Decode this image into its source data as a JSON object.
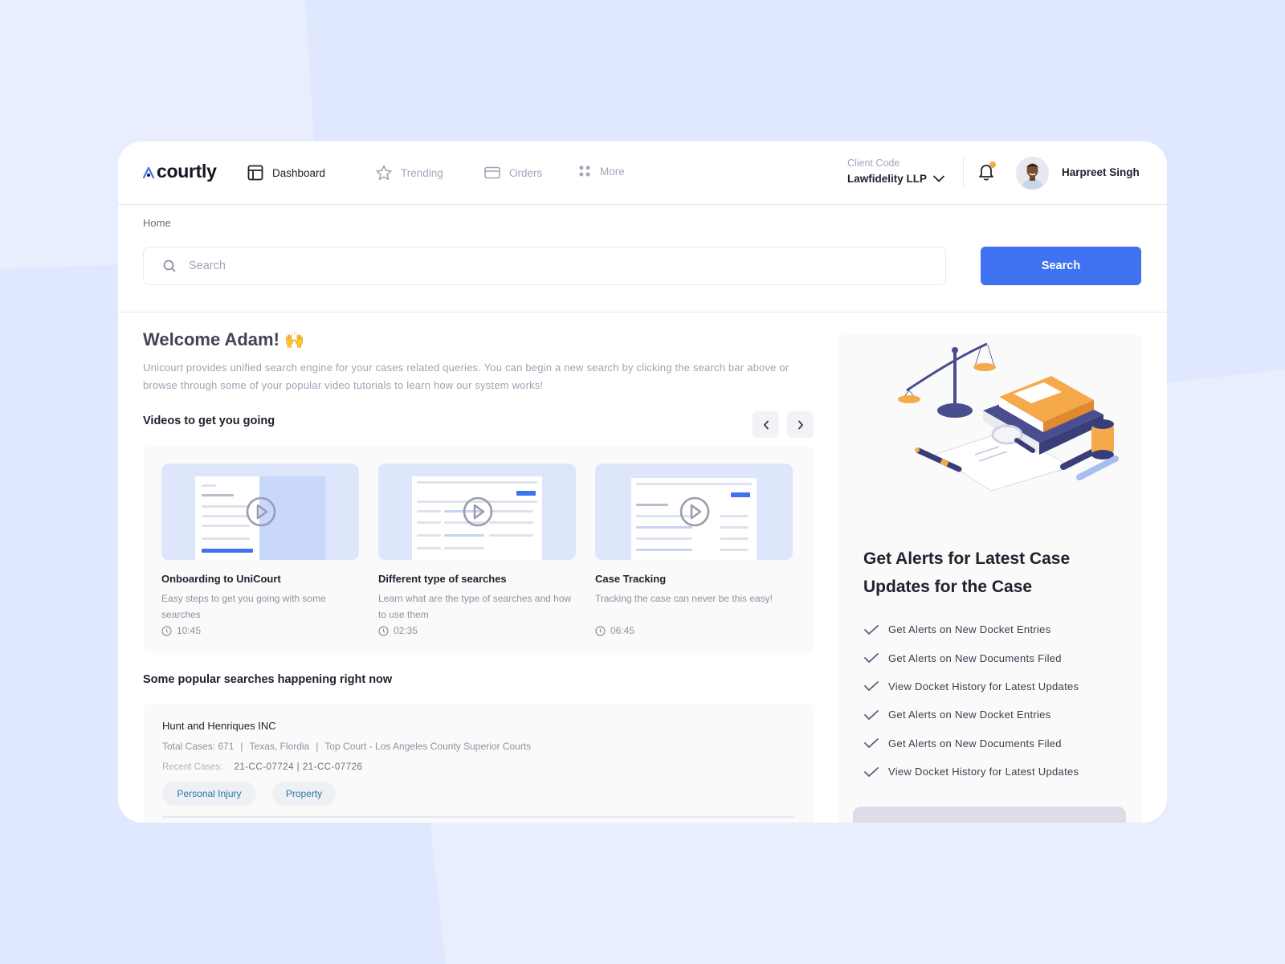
{
  "brand": {
    "name": "courtly",
    "accent": "#3f72f0",
    "highlight": "#f5a94a"
  },
  "nav": {
    "items": [
      {
        "label": "Dashboard",
        "icon": "dashboard-icon",
        "active": true
      },
      {
        "label": "Trending",
        "icon": "star-icon",
        "active": false
      },
      {
        "label": "Orders",
        "icon": "card-icon",
        "active": false
      },
      {
        "label": "More",
        "icon": "grid-dots-icon",
        "active": false
      }
    ]
  },
  "client": {
    "label": "Client Code",
    "value": "Lawfidelity LLP"
  },
  "user": {
    "name": "Harpreet Singh",
    "has_notification": true
  },
  "breadcrumb": "Home",
  "search": {
    "placeholder": "Search",
    "value": "",
    "button_label": "Search"
  },
  "welcome": {
    "title": "Welcome Adam!",
    "emoji": "🙌",
    "text": "Unicourt provides unified search engine for your cases related queries. You can begin a new search by clicking the search bar above or browse through some of your popular video tutorials to learn how our system works!"
  },
  "videos": {
    "title": "Videos to get you going",
    "prev_icon": "chevron-left-icon",
    "next_icon": "chevron-right-icon",
    "items": [
      {
        "title": "Onboarding to UniCourt",
        "description": "Easy steps to get you going with some searches",
        "duration": "10:45"
      },
      {
        "title": "Different type of searches",
        "description": "Learn what are the type of searches and how to use them",
        "duration": "02:35"
      },
      {
        "title": "Case Tracking",
        "description": "Tracking the case can never be this easy!",
        "duration": "06:45"
      }
    ]
  },
  "popular": {
    "title": "Some popular searches happening right now",
    "items": [
      {
        "name": "Hunt and Henriques INC",
        "total_cases": "Total Cases: 671",
        "locations": "Texas, Flordia",
        "top_court": "Top Court - Los Angeles County Superior Courts",
        "recent_label": "Recent Cases:",
        "recent_cases": "21-CC-07724 | 21-CC-07726",
        "tags": [
          "Personal Injury",
          "Property"
        ]
      }
    ]
  },
  "promo": {
    "title": "Get Alerts for Latest Case Updates for the Case",
    "features": [
      "Get Alerts on New Docket Entries",
      "Get Alerts on New Documents Filed",
      "View Docket History for Latest Updates",
      "Get Alerts on New Docket Entries",
      "Get Alerts on New Documents Filed",
      "View Docket History for Latest Updates"
    ]
  }
}
